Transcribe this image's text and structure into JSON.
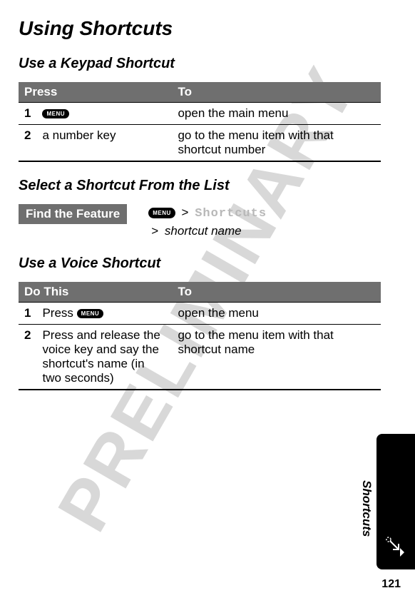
{
  "watermark": "PRELIMINARY",
  "title": "Using Shortcuts",
  "section1": {
    "heading": "Use a Keypad Shortcut",
    "table": {
      "head": {
        "c1": "Press",
        "c2": "To"
      },
      "rows": [
        {
          "n": "1",
          "press": "",
          "menu_label": "MENU",
          "to": "open the main menu"
        },
        {
          "n": "2",
          "press": "a number key",
          "to": "go to the menu item with that shortcut number"
        }
      ]
    }
  },
  "section2": {
    "heading": "Select a Shortcut From the List",
    "feature_label": "Find the Feature",
    "menu_label": "MENU",
    "gt1": ">",
    "path1": "Shortcuts",
    "gt2": ">",
    "path2": "shortcut name"
  },
  "section3": {
    "heading": "Use a Voice Shortcut",
    "table": {
      "head": {
        "c1": "Do This",
        "c2": "To"
      },
      "rows": [
        {
          "n": "1",
          "press": "Press ",
          "menu_label": "MENU",
          "to": "open the menu"
        },
        {
          "n": "2",
          "press": "Press and release the voice key and say the shortcut's name (in two seconds)",
          "to": "go to the menu item with that shortcut name"
        }
      ]
    }
  },
  "side_label": "Shortcuts",
  "page_num": "121"
}
